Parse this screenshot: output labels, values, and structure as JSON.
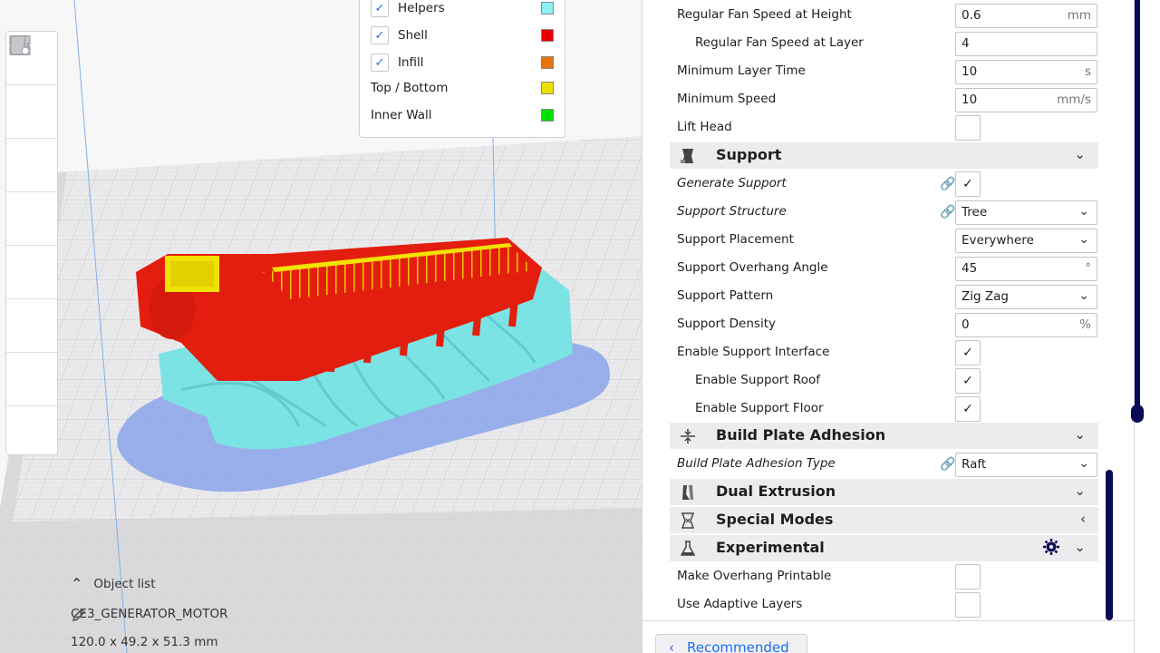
{
  "legend": {
    "items": [
      {
        "label": "Helpers",
        "checked": true,
        "color": "#8ef0f0"
      },
      {
        "label": "Shell",
        "checked": true,
        "color": "#e60000"
      },
      {
        "label": "Infill",
        "checked": true,
        "color": "#e8720c"
      },
      {
        "label": "Top / Bottom",
        "checked": null,
        "color": "#ece000"
      },
      {
        "label": "Inner Wall",
        "checked": null,
        "color": "#00e000"
      }
    ]
  },
  "object_list": {
    "title": "Object list",
    "object_name": "CE3_GENERATOR_MOTOR",
    "dimensions": "120.0 x 49.2 x 51.3 mm"
  },
  "settings": {
    "fan_speed_height": {
      "label": "Regular Fan Speed at Height",
      "value": "0.6",
      "unit": "mm"
    },
    "fan_speed_layer": {
      "label": "Regular Fan Speed at Layer",
      "value": "4"
    },
    "min_layer_time": {
      "label": "Minimum Layer Time",
      "value": "10",
      "unit": "s"
    },
    "min_speed": {
      "label": "Minimum Speed",
      "value": "10",
      "unit": "mm/s"
    },
    "lift_head": {
      "label": "Lift Head",
      "checked": false
    },
    "support": {
      "title": "Support"
    },
    "generate_support": {
      "label": "Generate Support",
      "checked": true
    },
    "support_structure": {
      "label": "Support Structure",
      "value": "Tree"
    },
    "support_placement": {
      "label": "Support Placement",
      "value": "Everywhere"
    },
    "support_overhang": {
      "label": "Support Overhang Angle",
      "value": "45",
      "unit": "°"
    },
    "support_pattern": {
      "label": "Support Pattern",
      "value": "Zig Zag"
    },
    "support_density": {
      "label": "Support Density",
      "value": "0",
      "unit": "%"
    },
    "support_interface": {
      "label": "Enable Support Interface",
      "checked": true
    },
    "support_roof": {
      "label": "Enable Support Roof",
      "checked": true
    },
    "support_floor": {
      "label": "Enable Support Floor",
      "checked": true
    },
    "adhesion": {
      "title": "Build Plate Adhesion"
    },
    "adhesion_type": {
      "label": "Build Plate Adhesion Type",
      "value": "Raft"
    },
    "dual_extrusion": {
      "title": "Dual Extrusion"
    },
    "special_modes": {
      "title": "Special Modes"
    },
    "experimental": {
      "title": "Experimental"
    },
    "overhang_printable": {
      "label": "Make Overhang Printable",
      "checked": false
    },
    "adaptive_layers": {
      "label": "Use Adaptive Layers",
      "checked": false
    }
  },
  "footer": {
    "recommended_label": "Recommended"
  },
  "icons": {
    "check": "✓",
    "chevron_down": "⌄",
    "chevron_left": "‹",
    "chevron_up": "⌃",
    "link": "link-icon",
    "reset": "reset-icon"
  },
  "colors": {
    "accent": "#196ef0",
    "scroll": "#0a0a55",
    "category_bg": "#ececef"
  }
}
